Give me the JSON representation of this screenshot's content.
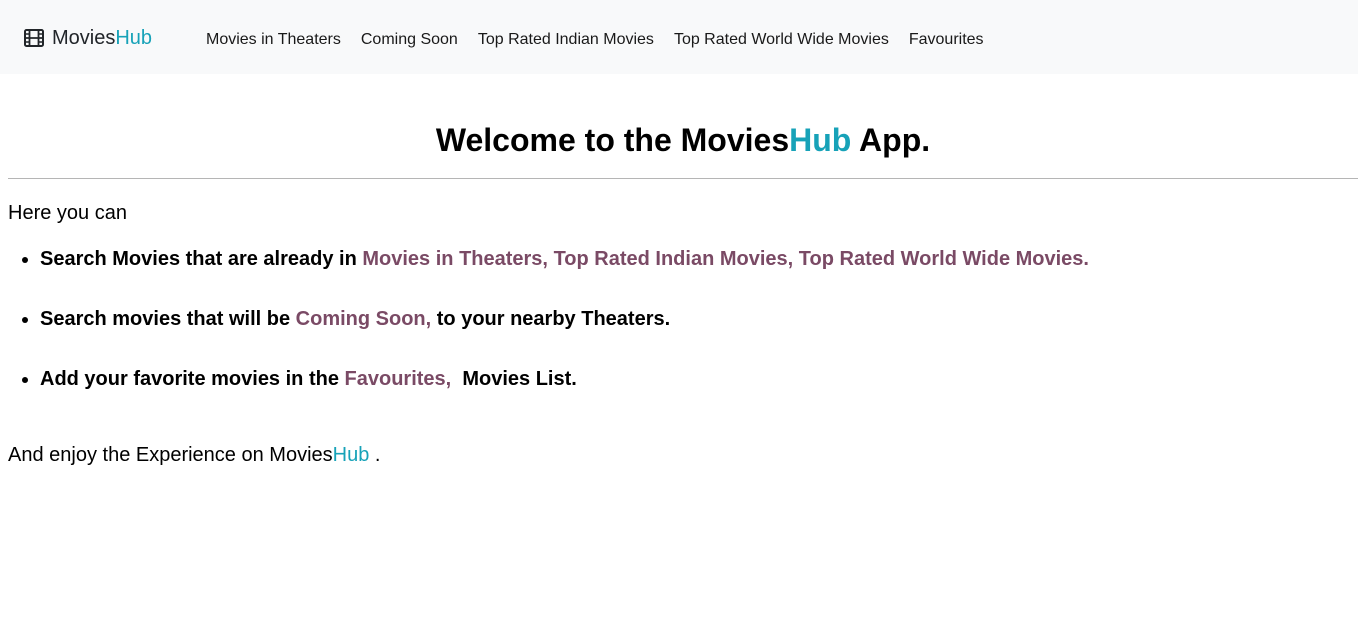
{
  "navbar": {
    "brand": {
      "icon": "film-icon",
      "prefix": "Movies",
      "suffix": "Hub"
    },
    "links": [
      {
        "label": "Movies in Theaters"
      },
      {
        "label": "Coming Soon"
      },
      {
        "label": "Top Rated Indian Movies"
      },
      {
        "label": "Top Rated World Wide Movies"
      },
      {
        "label": "Favourites"
      }
    ]
  },
  "main": {
    "heading": {
      "pre": "Welcome to the ",
      "brand_prefix": "Movies",
      "brand_suffix": "Hub",
      "post": " App."
    },
    "intro": "Here you can",
    "features": [
      {
        "text_pre": "Search Movies that are already in ",
        "link1": "Movies in Theaters,",
        "link2": "Top Rated Indian Movies,",
        "link3": "Top Rated World Wide Movies."
      },
      {
        "text_pre": "Search movies that will be ",
        "link1": "Coming Soon,",
        "text_post": " to your nearby Theaters."
      },
      {
        "text_pre": "Add your favorite movies in the ",
        "link1": "Favourites,",
        "text_post": "  Movies List."
      }
    ],
    "outro": {
      "pre": "And enjoy the Experience on ",
      "brand_prefix": "Movies",
      "brand_suffix": "Hub",
      "post": " ."
    }
  },
  "colors": {
    "accent": "#17a2b8",
    "link": "#7a4a65",
    "navbar_bg": "#f8f9fa"
  }
}
